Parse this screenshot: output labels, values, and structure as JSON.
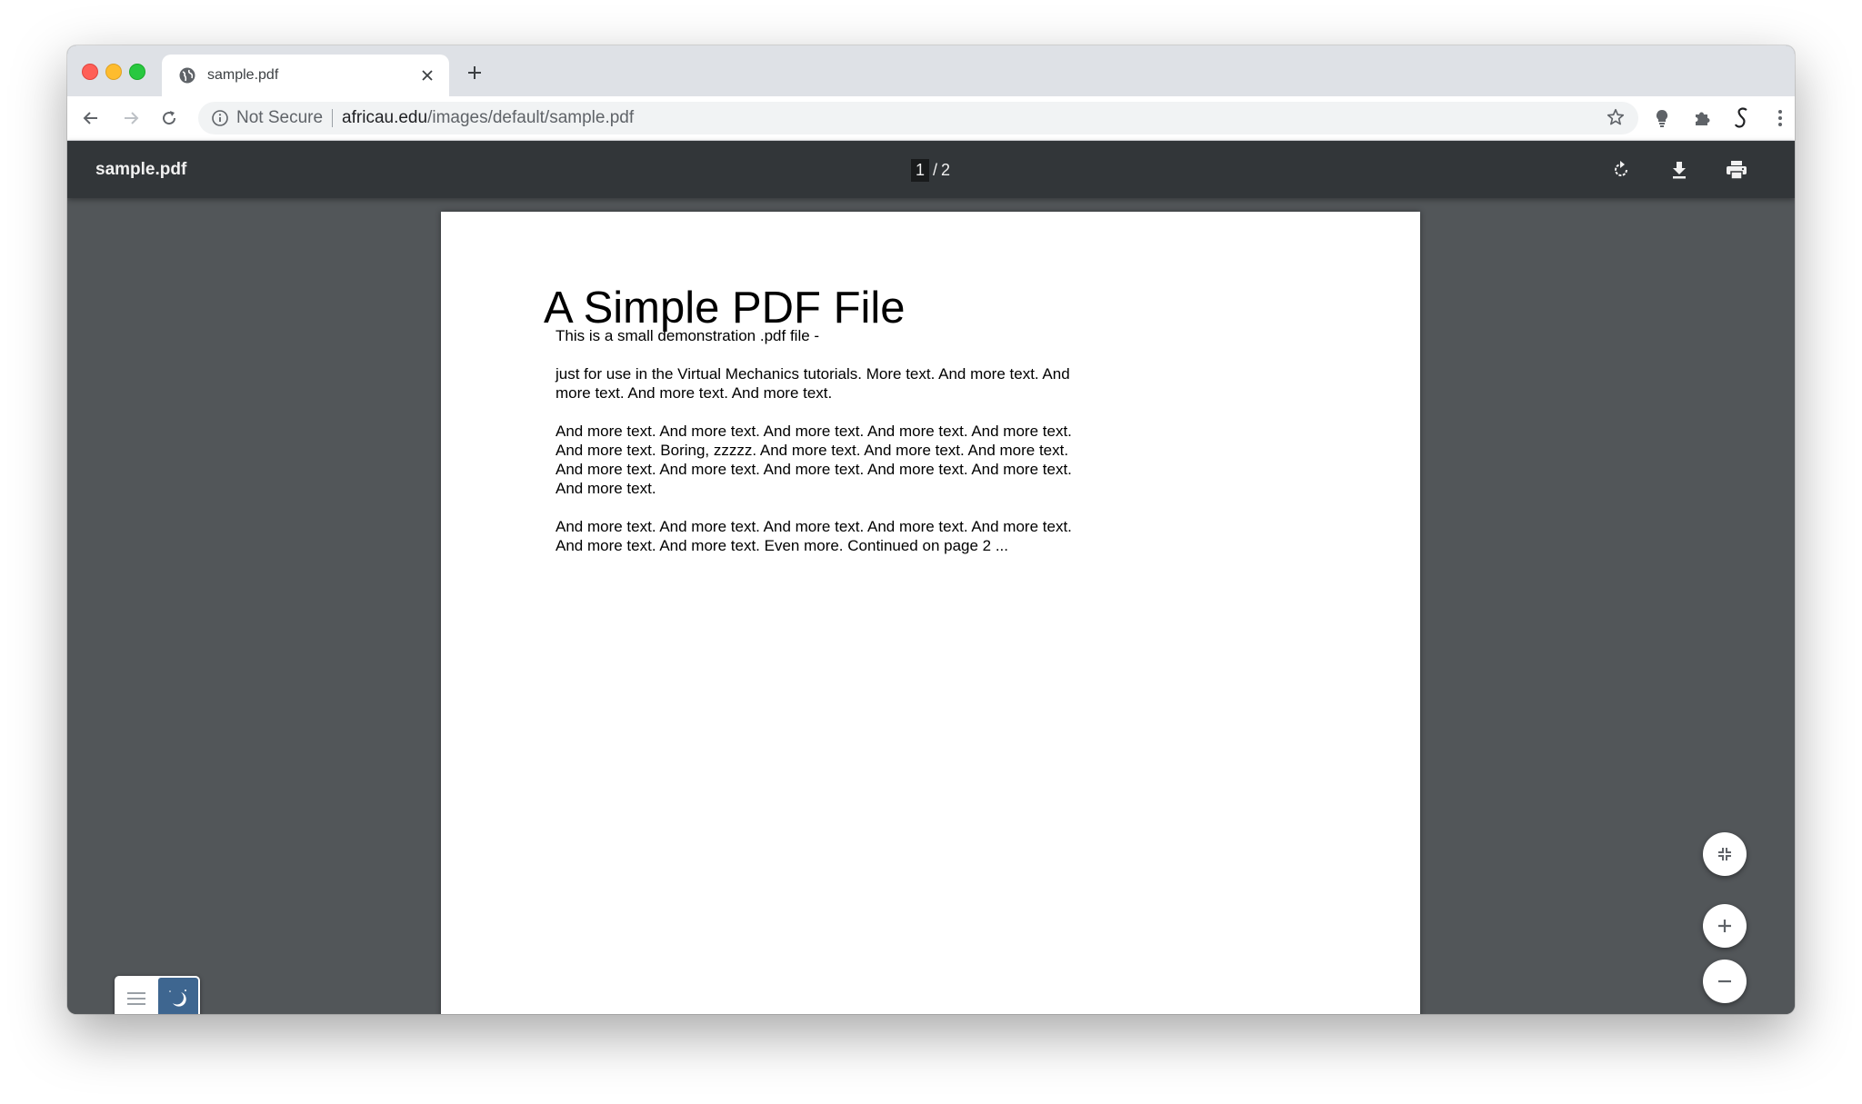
{
  "browser": {
    "tab": {
      "title": "sample.pdf",
      "favicon": "globe-icon"
    },
    "omnibox": {
      "security_label": "Not Secure",
      "url_host": "africau.edu",
      "url_path": "/images/default/sample.pdf"
    },
    "colors": {
      "tabstrip": "#dee1e6",
      "toolbar": "#ffffff",
      "omnibox": "#f1f3f4"
    }
  },
  "pdf_toolbar": {
    "title": "sample.pdf",
    "page_current": "1",
    "page_separator": "/",
    "page_total": "2",
    "buttons": [
      "rotate-icon",
      "download-icon",
      "print-icon"
    ]
  },
  "document": {
    "heading": "A Simple PDF File",
    "paragraphs": [
      "This is a small demonstration .pdf file -",
      "just for use in the Virtual Mechanics tutorials. More text. And more text. And more text. And more text. And more text.",
      "And more text. And more text. And more text. And more text. And more text. And more text. Boring, zzzzz. And more text. And more text. And more text. And more text. And more text. And more text. And more text. And more text. And more text.",
      "And more text. And more text. And more text. And more text. And more text. And more text. And more text. Even more. Continued on page 2 ..."
    ]
  },
  "viewer": {
    "background": "#525659",
    "controls": [
      "fit-to-page-icon",
      "zoom-in-icon",
      "zoom-out-icon"
    ],
    "theme_toggle": {
      "selected": "dark",
      "accent": "#3e6690"
    }
  }
}
